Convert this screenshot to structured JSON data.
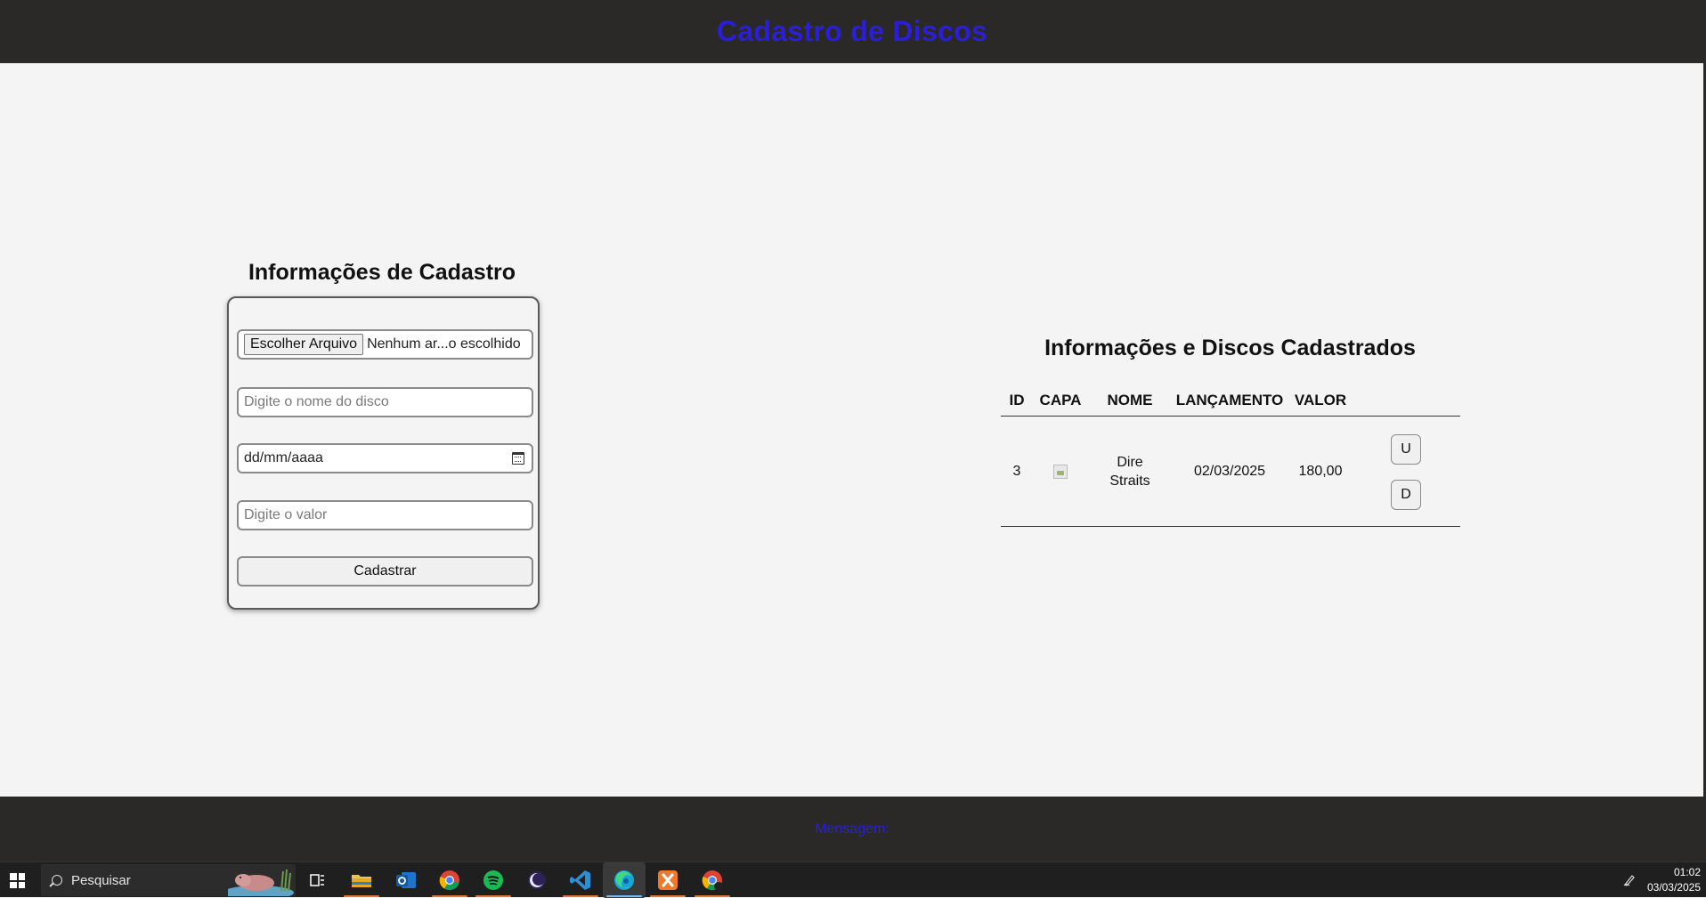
{
  "header": {
    "title": "Cadastro de Discos"
  },
  "form": {
    "title": "Informações de Cadastro",
    "file_button_label": "Escolher Arquivo",
    "file_status": "Nenhum ar...o escolhido",
    "name_placeholder": "Digite o nome do disco",
    "date_placeholder": "dd/mm/aaaa",
    "value_placeholder": "Digite o valor",
    "submit_label": "Cadastrar"
  },
  "table": {
    "title": "Informações e Discos Cadastrados",
    "columns": [
      "ID",
      "CAPA",
      "NOME",
      "LANÇAMENTO",
      "VALOR"
    ],
    "rows": [
      {
        "id": "3",
        "name_line1": "Dire",
        "name_line2": "Straits",
        "release": "02/03/2025",
        "value": "180,00",
        "update_label": "U",
        "delete_label": "D"
      }
    ]
  },
  "footer": {
    "message_label": "Mensagem:"
  },
  "taskbar": {
    "search_label": "Pesquisar",
    "apps": [
      "task-view-icon",
      "file-explorer-icon",
      "outlook-icon",
      "chrome-icon",
      "spotify-icon",
      "eclipse-icon",
      "vscode-icon",
      "edge-icon",
      "xampp-icon",
      "chrome-alt-icon"
    ],
    "clock_time": "01:02",
    "clock_date": "03/03/2025"
  },
  "colors": {
    "accent": "#2a1fd6",
    "bar_bg": "#2b2928",
    "page_bg": "#f4f4f4"
  }
}
